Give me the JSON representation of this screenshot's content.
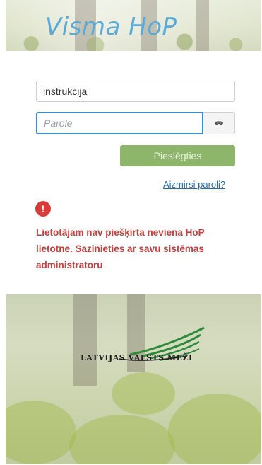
{
  "header": {
    "brand": "Visma HoP"
  },
  "login_form": {
    "username_value": "instrukcija",
    "password_placeholder": "Parole",
    "password_value": "",
    "show_password_icon": "eye-icon",
    "login_label": "Pieslēgties",
    "forgot_link": "Aizmirsi paroli?"
  },
  "error": {
    "icon": "exclamation-icon",
    "message": "Lietotājam nav piešķirta neviena HoP lietotne. Sazinieties ar savu sistēmas administratoru"
  },
  "footer": {
    "logo_text": "LATVIJAS VALSTS MEŽI"
  },
  "colors": {
    "brand_blue": "#5aa9d6",
    "login_green": "#8db66b",
    "error_red": "#c3413f",
    "focus_blue": "#3c8ed0",
    "link_blue": "#1f6fb5"
  }
}
